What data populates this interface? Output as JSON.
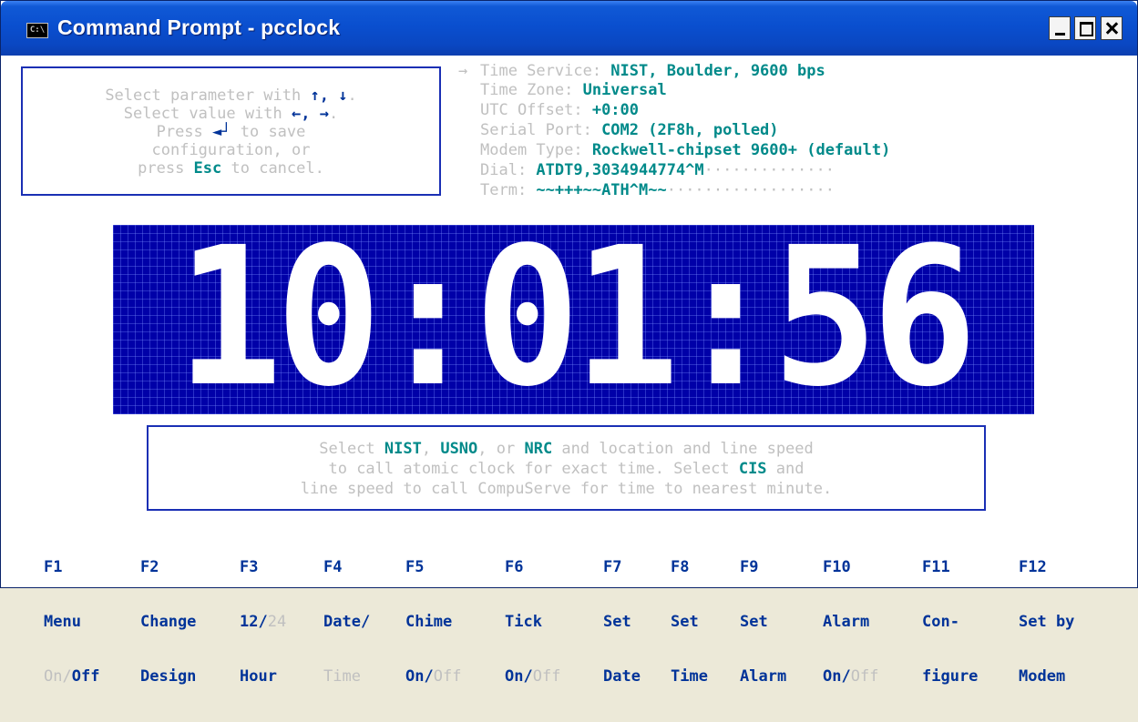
{
  "window": {
    "title": "Command Prompt - pcclock",
    "icon": "C:\\"
  },
  "help": {
    "line1_a": "Select parameter with ",
    "line1_arrows": "↑, ↓",
    "line1_b": ".",
    "line2_a": "Select value with ",
    "line2_arrows": "←, →",
    "line2_b": ".",
    "line3_a": "Press ",
    "line3_key": "◄┘",
    "line3_b": " to save",
    "line4": "configuration, or",
    "line5_a": "press ",
    "line5_key": "Esc",
    "line5_b": " to cancel."
  },
  "settings": {
    "pointer": "→",
    "time_service_label": "Time Service: ",
    "time_service_value": "NIST, Boulder, 9600 bps",
    "time_zone_label": "Time Zone: ",
    "time_zone_value": "Universal",
    "utc_offset_label": "UTC Offset: ",
    "utc_offset_value": "+0:00",
    "serial_port_label": "Serial Port: ",
    "serial_port_value": "COM2 (2F8h, polled)",
    "modem_type_label": "Modem Type: ",
    "modem_type_value": "Rockwell-chipset 9600+ (default)",
    "dial_label": "Dial: ",
    "dial_value": "ATDT9,3034944774^M",
    "dial_fill": "··············",
    "term_label": "Term: ",
    "term_value": "~~+++~~ATH^M~~",
    "term_fill": "··················"
  },
  "clock": {
    "time": "10:01:56"
  },
  "description": {
    "line1_a": "Select ",
    "nist": "NIST",
    "line1_b": ", ",
    "usno": "USNO",
    "line1_c": ", or ",
    "nrc": "NRC",
    "line1_d": " and location and line speed",
    "line2_a": "to call atomic clock for exact time. Select ",
    "cis": "CIS",
    "line2_b": " and",
    "line3": "line speed to call CompuServe for time to nearest minute."
  },
  "fkeys": [
    {
      "key": "F1",
      "l2": "Menu",
      "l3_on": "On/",
      "l3_off": "Off"
    },
    {
      "key": "F2",
      "l2": "Change",
      "l3": "Design"
    },
    {
      "key": "F3",
      "l2a": "12/",
      "l2b": "24",
      "l3": "Hour"
    },
    {
      "key": "F4",
      "l2": "Date/",
      "l3": "Time"
    },
    {
      "key": "F5",
      "l2": "Chime",
      "l3_on": "On/",
      "l3_off": "Off"
    },
    {
      "key": "F6",
      "l2": "Tick",
      "l3_on": "On/",
      "l3_off": "Off"
    },
    {
      "key": "F7",
      "l2": "Set",
      "l3": "Date"
    },
    {
      "key": "F8",
      "l2": "Set",
      "l3": "Time"
    },
    {
      "key": "F9",
      "l2": "Set",
      "l3": "Alarm"
    },
    {
      "key": "F10",
      "l2": "Alarm",
      "l3_on": "On/",
      "l3_off": "Off"
    },
    {
      "key": "F11",
      "l2": "Con-",
      "l3": "figure"
    },
    {
      "key": "F12",
      "l2": "Set by",
      "l3": "Modem"
    }
  ]
}
